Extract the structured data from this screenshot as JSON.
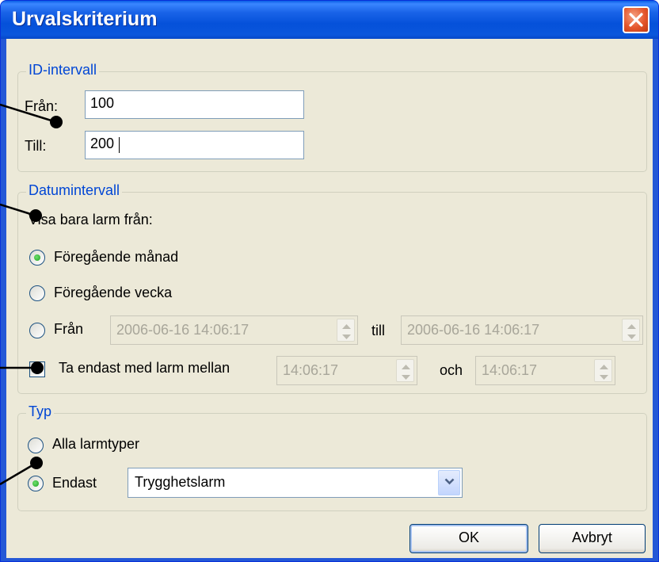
{
  "window": {
    "title": "Urvalskriterium"
  },
  "id_interval": {
    "legend": "ID-intervall",
    "from_label": "Från:",
    "from_value": "100",
    "to_label": "Till:",
    "to_value": "200"
  },
  "date_interval": {
    "legend": "Datumintervall",
    "caption": "Visa bara larm från:",
    "option_prev_month": "Föregående månad",
    "option_prev_week": "Föregående vecka",
    "option_from": "Från",
    "from_datetime": "2006-06-16 14:06:17",
    "till_label": "till",
    "to_datetime": "2006-06-16 14:06:17",
    "between_label": "Ta endast med larm mellan",
    "between_from": "14:06:17",
    "and_label": "och",
    "between_to": "14:06:17"
  },
  "type": {
    "legend": "Typ",
    "option_all": "Alla larmtyper",
    "option_only": "Endast",
    "selected_type": "Trygghetslarm"
  },
  "buttons": {
    "ok": "OK",
    "cancel": "Avbryt"
  },
  "colors": {
    "accent": "#0046d5",
    "title_bar": "#0551da",
    "dialog_bg": "#ece9d8"
  }
}
